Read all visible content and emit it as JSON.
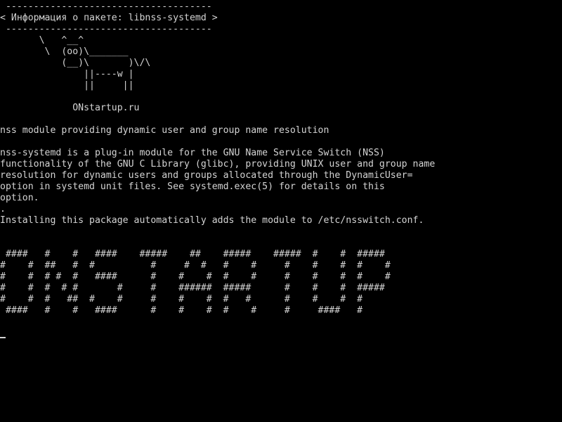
{
  "cowsay": {
    "top_border": " -------------------------------------",
    "title_line": "< Информация о пакете: libnss-systemd >",
    "bottom_border": " -------------------------------------",
    "cow": [
      "       \\   ^__^",
      "        \\  (oo)\\_______",
      "           (__)\\       )\\/\\",
      "               ||----w |",
      "               ||     ||"
    ]
  },
  "site_line": "             ONstartup.ru",
  "summary": "nss module providing dynamic user and group name resolution",
  "description": [
    "nss-systemd is a plug-in module for the GNU Name Service Switch (NSS)",
    "functionality of the GNU C Library (glibc), providing UNIX user and group name",
    "resolution for dynamic users and groups allocated through the DynamicUser=",
    "option in systemd unit files. See systemd.exec(5) for details on this",
    "option.",
    ".",
    "Installing this package automatically adds the module to /etc/nsswitch.conf."
  ],
  "banner": [
    " ####   #    #   ####    #####    ##    #####    #####  #    #  #####",
    "#    #  ##   #  #          #     #  #   #    #     #    #    #  #    #",
    "#    #  # #  #   ####      #    #    #  #    #     #    #    #  #    #",
    "#    #  #  # #       #     #    ######  #####      #    #    #  #####",
    "#    #  #   ##  #    #     #    #    #  #   #      #    #    #  #",
    " ####   #    #   ####      #    #    #  #    #     #     ####   #"
  ],
  "colors": {
    "background": "#000000",
    "foreground": "#d4d4d4"
  }
}
